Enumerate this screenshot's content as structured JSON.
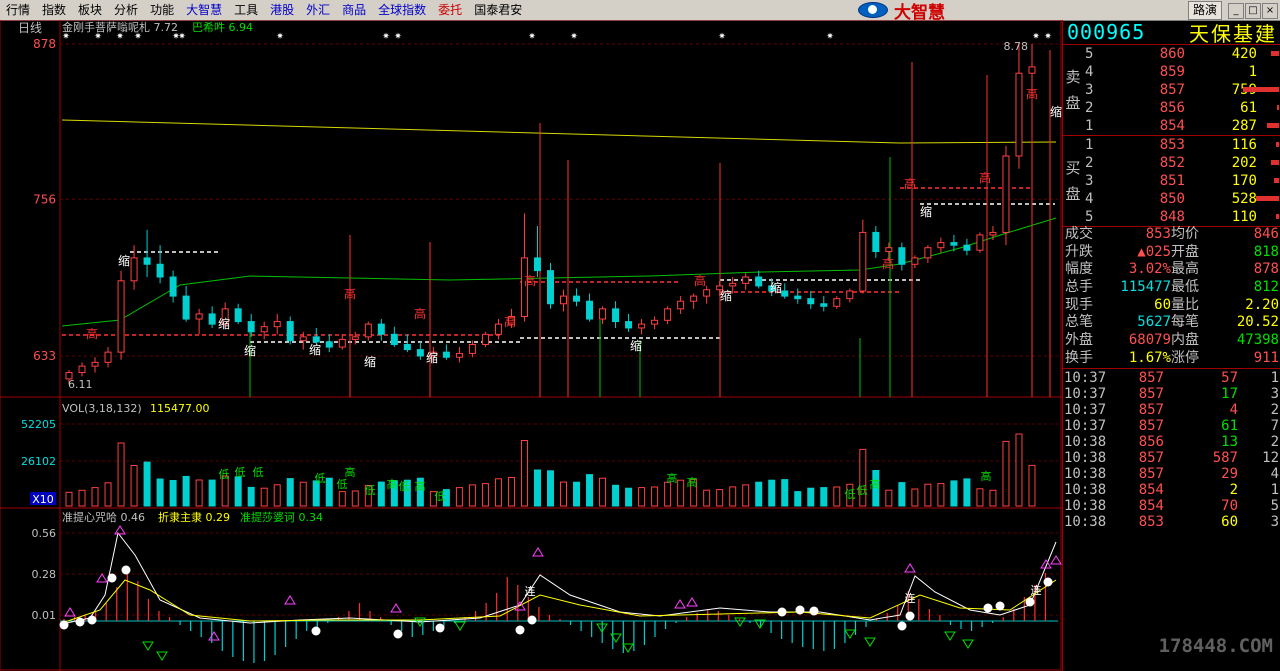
{
  "menu": {
    "items": [
      {
        "label": "行情",
        "style": ""
      },
      {
        "label": "指数",
        "style": ""
      },
      {
        "label": "板块",
        "style": ""
      },
      {
        "label": "分析",
        "style": ""
      },
      {
        "label": "功能",
        "style": ""
      },
      {
        "label": "大智慧",
        "style": "blue"
      },
      {
        "label": "工具",
        "style": ""
      },
      {
        "label": "港股",
        "style": "blue"
      },
      {
        "label": "外汇",
        "style": "blue"
      },
      {
        "label": "商品",
        "style": "blue"
      },
      {
        "label": "全球指数",
        "style": "blue"
      },
      {
        "label": "委托",
        "style": "red"
      },
      {
        "label": "国泰君安",
        "style": ""
      }
    ],
    "logo_text": "大智慧",
    "road_button": "路演"
  },
  "chart": {
    "period_label": "日线",
    "ma_legend": [
      {
        "text": "金刚手菩萨嗡呢札 7.72",
        "color": "#c0c0c0"
      },
      {
        "text": "巴希吽 6.94",
        "color": "#00e000"
      }
    ],
    "price_axis": [
      "878",
      "756",
      "633"
    ],
    "high_label": "8.78",
    "low_label": "6.11",
    "vol_legend": "VOL(3,18,132)",
    "vol_value": "115477.00",
    "vol_axis": [
      "52205",
      "26102"
    ],
    "vol_unit": "X10",
    "ind_legend": [
      {
        "text": "准提心咒哈 0.46",
        "color": "#c0c0c0"
      },
      {
        "text": "折隶主隶 0.29",
        "color": "#ffff00"
      },
      {
        "text": "准提莎婆诃 0.34",
        "color": "#00e000"
      }
    ],
    "ind_axis": [
      "0.56",
      "0.28",
      "0.01"
    ],
    "marks": {
      "high": "高",
      "low": "低",
      "shrink": "缩",
      "star": "✷",
      "cons": "连"
    }
  },
  "chart_data": {
    "type": "candlestick",
    "price_range": [
      6.11,
      8.78
    ],
    "ylim": [
      6.0,
      8.85
    ],
    "price_candles": [
      [
        6.15,
        6.22,
        6.11,
        6.2
      ],
      [
        6.2,
        6.28,
        6.17,
        6.25
      ],
      [
        6.25,
        6.32,
        6.2,
        6.28
      ],
      [
        6.28,
        6.4,
        6.24,
        6.36
      ],
      [
        6.36,
        7.0,
        6.3,
        6.92
      ],
      [
        6.92,
        7.2,
        6.85,
        7.1
      ],
      [
        7.1,
        7.32,
        6.95,
        7.05
      ],
      [
        7.05,
        7.2,
        6.9,
        6.95
      ],
      [
        6.95,
        7.0,
        6.75,
        6.8
      ],
      [
        6.8,
        6.88,
        6.6,
        6.62
      ],
      [
        6.62,
        6.7,
        6.5,
        6.66
      ],
      [
        6.66,
        6.72,
        6.55,
        6.58
      ],
      [
        6.58,
        6.75,
        6.55,
        6.7
      ],
      [
        6.7,
        6.74,
        6.58,
        6.6
      ],
      [
        6.6,
        6.66,
        6.48,
        6.52
      ],
      [
        6.52,
        6.6,
        6.46,
        6.56
      ],
      [
        6.56,
        6.66,
        6.5,
        6.6
      ],
      [
        6.6,
        6.64,
        6.42,
        6.45
      ],
      [
        6.45,
        6.52,
        6.38,
        6.48
      ],
      [
        6.48,
        6.55,
        6.42,
        6.44
      ],
      [
        6.44,
        6.5,
        6.36,
        6.4
      ],
      [
        6.4,
        6.5,
        6.38,
        6.46
      ],
      [
        6.46,
        6.52,
        6.42,
        6.48
      ],
      [
        6.48,
        6.6,
        6.45,
        6.58
      ],
      [
        6.58,
        6.62,
        6.45,
        6.5
      ],
      [
        6.5,
        6.56,
        6.4,
        6.42
      ],
      [
        6.42,
        6.5,
        6.36,
        6.38
      ],
      [
        6.38,
        6.44,
        6.3,
        6.33
      ],
      [
        6.33,
        6.4,
        6.28,
        6.36
      ],
      [
        6.36,
        6.42,
        6.3,
        6.32
      ],
      [
        6.32,
        6.4,
        6.28,
        6.35
      ],
      [
        6.35,
        6.45,
        6.32,
        6.42
      ],
      [
        6.42,
        6.52,
        6.4,
        6.5
      ],
      [
        6.5,
        6.62,
        6.46,
        6.58
      ],
      [
        6.58,
        6.7,
        6.55,
        6.64
      ],
      [
        6.64,
        7.45,
        6.6,
        7.1
      ],
      [
        7.1,
        7.35,
        6.95,
        7.0
      ],
      [
        7.0,
        7.06,
        6.7,
        6.74
      ],
      [
        6.74,
        6.85,
        6.68,
        6.8
      ],
      [
        6.8,
        6.86,
        6.72,
        6.76
      ],
      [
        6.76,
        6.82,
        6.6,
        6.62
      ],
      [
        6.62,
        6.72,
        6.58,
        6.7
      ],
      [
        6.7,
        6.76,
        6.55,
        6.6
      ],
      [
        6.6,
        6.66,
        6.52,
        6.55
      ],
      [
        6.55,
        6.62,
        6.5,
        6.58
      ],
      [
        6.58,
        6.64,
        6.54,
        6.61
      ],
      [
        6.61,
        6.72,
        6.58,
        6.7
      ],
      [
        6.7,
        6.8,
        6.66,
        6.76
      ],
      [
        6.76,
        6.82,
        6.7,
        6.8
      ],
      [
        6.8,
        6.88,
        6.74,
        6.85
      ],
      [
        6.85,
        6.92,
        6.8,
        6.88
      ],
      [
        6.88,
        6.95,
        6.82,
        6.9
      ],
      [
        6.9,
        6.98,
        6.85,
        6.95
      ],
      [
        6.95,
        7.0,
        6.86,
        6.88
      ],
      [
        6.88,
        6.94,
        6.8,
        6.84
      ],
      [
        6.84,
        6.9,
        6.78,
        6.8
      ],
      [
        6.8,
        6.86,
        6.74,
        6.78
      ],
      [
        6.78,
        6.84,
        6.7,
        6.74
      ],
      [
        6.74,
        6.8,
        6.68,
        6.72
      ],
      [
        6.72,
        6.8,
        6.7,
        6.78
      ],
      [
        6.78,
        6.86,
        6.75,
        6.84
      ],
      [
        6.84,
        7.4,
        6.82,
        7.3
      ],
      [
        7.3,
        7.35,
        7.1,
        7.15
      ],
      [
        7.15,
        7.22,
        7.08,
        7.18
      ],
      [
        7.18,
        7.22,
        7.0,
        7.05
      ],
      [
        7.05,
        7.12,
        7.02,
        7.1
      ],
      [
        7.1,
        7.2,
        7.06,
        7.18
      ],
      [
        7.18,
        7.26,
        7.14,
        7.22
      ],
      [
        7.22,
        7.28,
        7.15,
        7.2
      ],
      [
        7.2,
        7.25,
        7.12,
        7.16
      ],
      [
        7.16,
        7.3,
        7.14,
        7.28
      ],
      [
        7.28,
        7.35,
        7.24,
        7.3
      ],
      [
        7.3,
        7.98,
        7.2,
        7.9
      ],
      [
        7.9,
        8.78,
        7.8,
        8.55
      ],
      [
        8.55,
        8.78,
        8.4,
        8.6
      ]
    ],
    "volume_range": [
      0,
      52205
    ],
    "indicator_range": [
      0.01,
      0.56
    ]
  },
  "quote": {
    "code": "000965",
    "name": "天保基建",
    "sell_label": [
      "卖",
      "盘"
    ],
    "buy_label": [
      "买",
      "盘"
    ],
    "sell": [
      {
        "n": "5",
        "price": "860",
        "vol": "420",
        "bar": 0.18
      },
      {
        "n": "4",
        "price": "859",
        "vol": "1",
        "bar": 0.0
      },
      {
        "n": "3",
        "price": "857",
        "vol": "759",
        "bar": 0.85
      },
      {
        "n": "2",
        "price": "856",
        "vol": "61",
        "bar": 0.05
      },
      {
        "n": "1",
        "price": "854",
        "vol": "287",
        "bar": 0.28
      }
    ],
    "buy": [
      {
        "n": "1",
        "price": "853",
        "vol": "116",
        "bar": 0.08
      },
      {
        "n": "2",
        "price": "852",
        "vol": "202",
        "bar": 0.18
      },
      {
        "n": "3",
        "price": "851",
        "vol": "170",
        "bar": 0.12
      },
      {
        "n": "4",
        "price": "850",
        "vol": "528",
        "bar": 0.55
      },
      {
        "n": "5",
        "price": "848",
        "vol": "110",
        "bar": 0.08
      }
    ],
    "stats": [
      {
        "l1": "成交",
        "v1": "853",
        "c1": "c-red",
        "l2": "均价",
        "v2": "846",
        "c2": "c-red"
      },
      {
        "l1": "升跌",
        "v1": "▲025",
        "c1": "c-red",
        "l2": "开盘",
        "v2": "818",
        "c2": "c-grn"
      },
      {
        "l1": "幅度",
        "v1": "3.02%",
        "c1": "c-red",
        "l2": "最高",
        "v2": "878",
        "c2": "c-red"
      },
      {
        "l1": "总手",
        "v1": "115477",
        "c1": "c-cy",
        "l2": "最低",
        "v2": "812",
        "c2": "c-grn"
      },
      {
        "l1": "现手",
        "v1": "60",
        "c1": "c-yel",
        "l2": "量比",
        "v2": "2.20",
        "c2": "c-yel"
      },
      {
        "l1": "总笔",
        "v1": "5627",
        "c1": "c-cy",
        "l2": "每笔",
        "v2": "20.52",
        "c2": "c-yel"
      },
      {
        "l1": "外盘",
        "v1": "68079",
        "c1": "c-red",
        "l2": "内盘",
        "v2": "47398",
        "c2": "c-grn"
      },
      {
        "l1": "换手",
        "v1": "1.67%",
        "c1": "c-yel",
        "l2": "涨停",
        "v2": "911",
        "c2": "c-red"
      }
    ],
    "ticks": [
      {
        "t": "10:37",
        "p": "857",
        "v": "57",
        "vc": "c-red",
        "n": "1"
      },
      {
        "t": "10:37",
        "p": "857",
        "v": "17",
        "vc": "c-grn",
        "n": "3"
      },
      {
        "t": "10:37",
        "p": "857",
        "v": "4",
        "vc": "c-red",
        "n": "2"
      },
      {
        "t": "10:37",
        "p": "857",
        "v": "61",
        "vc": "c-grn",
        "n": "7"
      },
      {
        "t": "10:38",
        "p": "856",
        "v": "13",
        "vc": "c-grn",
        "n": "2"
      },
      {
        "t": "10:38",
        "p": "857",
        "v": "587",
        "vc": "c-red",
        "n": "12"
      },
      {
        "t": "10:38",
        "p": "857",
        "v": "29",
        "vc": "c-red",
        "n": "4"
      },
      {
        "t": "10:38",
        "p": "854",
        "v": "2",
        "vc": "c-yel",
        "n": "1"
      },
      {
        "t": "10:38",
        "p": "854",
        "v": "70",
        "vc": "c-red",
        "n": "5"
      },
      {
        "t": "10:38",
        "p": "853",
        "v": "60",
        "vc": "c-yel",
        "n": "3"
      }
    ]
  },
  "watermark": "178448.COM"
}
